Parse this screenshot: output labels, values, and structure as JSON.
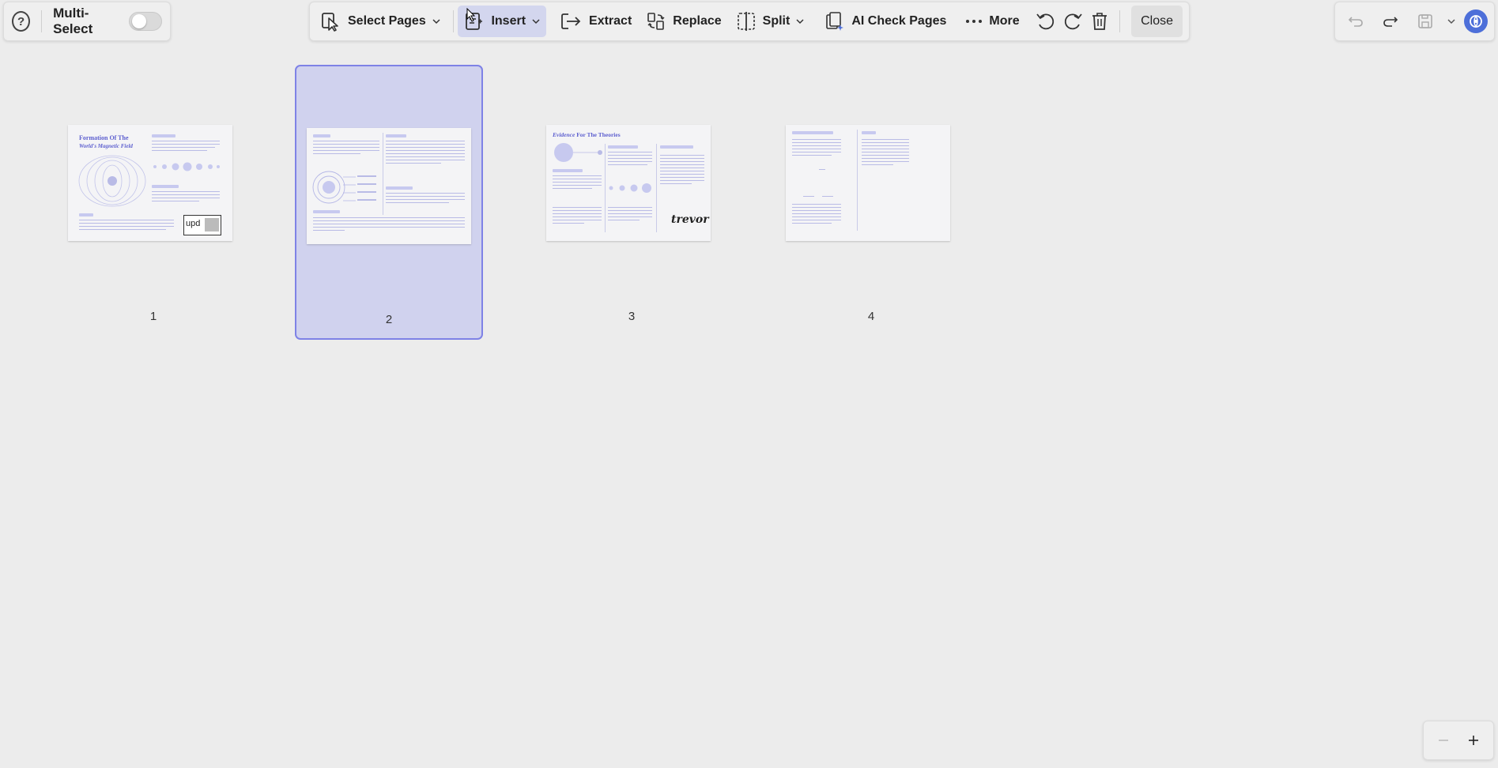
{
  "multi_select": {
    "label": "Multi-Select",
    "enabled": false
  },
  "toolbar": {
    "select_pages": "Select Pages",
    "insert": "Insert",
    "extract": "Extract",
    "replace": "Replace",
    "split": "Split",
    "ai_check_pages": "AI Check Pages",
    "more": "More",
    "close": "Close",
    "active_tool": "insert"
  },
  "pages": [
    {
      "number": "1",
      "selected": false,
      "title_line1": "Formation Of The",
      "title_line2": "World's Magnetic Field",
      "logo_text": "upd"
    },
    {
      "number": "2",
      "selected": true
    },
    {
      "number": "3",
      "selected": false,
      "title_italic": "Evidence",
      "title_rest": " For The Theories",
      "signature": "trevor"
    },
    {
      "number": "4",
      "selected": false
    }
  ],
  "colors": {
    "accent": "#7e82e6",
    "selected_bg": "#d0d2ee",
    "thumb_text": "#5d5fcf"
  }
}
